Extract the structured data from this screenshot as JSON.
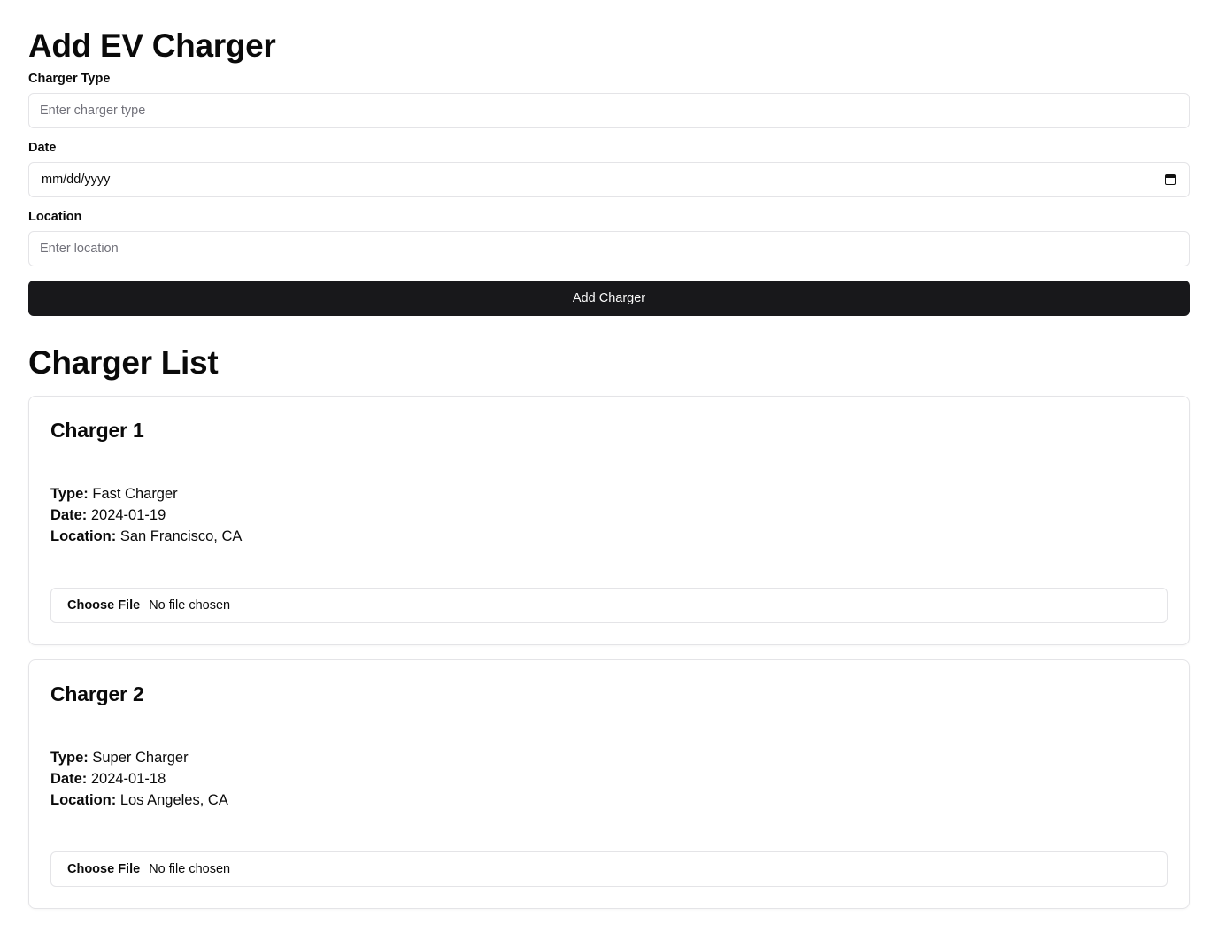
{
  "form": {
    "title": "Add EV Charger",
    "charger_type": {
      "label": "Charger Type",
      "placeholder": "Enter charger type",
      "value": ""
    },
    "date": {
      "label": "Date",
      "placeholder": "mm/dd/yyyy",
      "value": ""
    },
    "location": {
      "label": "Location",
      "placeholder": "Enter location",
      "value": ""
    },
    "submit_label": "Add Charger"
  },
  "list": {
    "title": "Charger List",
    "labels": {
      "type": "Type:",
      "date": "Date:",
      "location": "Location:"
    },
    "file_button": "Choose File",
    "file_status": "No file chosen",
    "chargers": [
      {
        "name": "Charger 1",
        "type": "Fast Charger",
        "date": "2024-01-19",
        "location": "San Francisco, CA"
      },
      {
        "name": "Charger 2",
        "type": "Super Charger",
        "date": "2024-01-18",
        "location": "Los Angeles, CA"
      }
    ]
  },
  "colors": {
    "button_bg": "#18181b",
    "border": "#e4e4e7",
    "placeholder": "#71717a"
  },
  "icons": {
    "date_picker": "calendar-icon"
  }
}
